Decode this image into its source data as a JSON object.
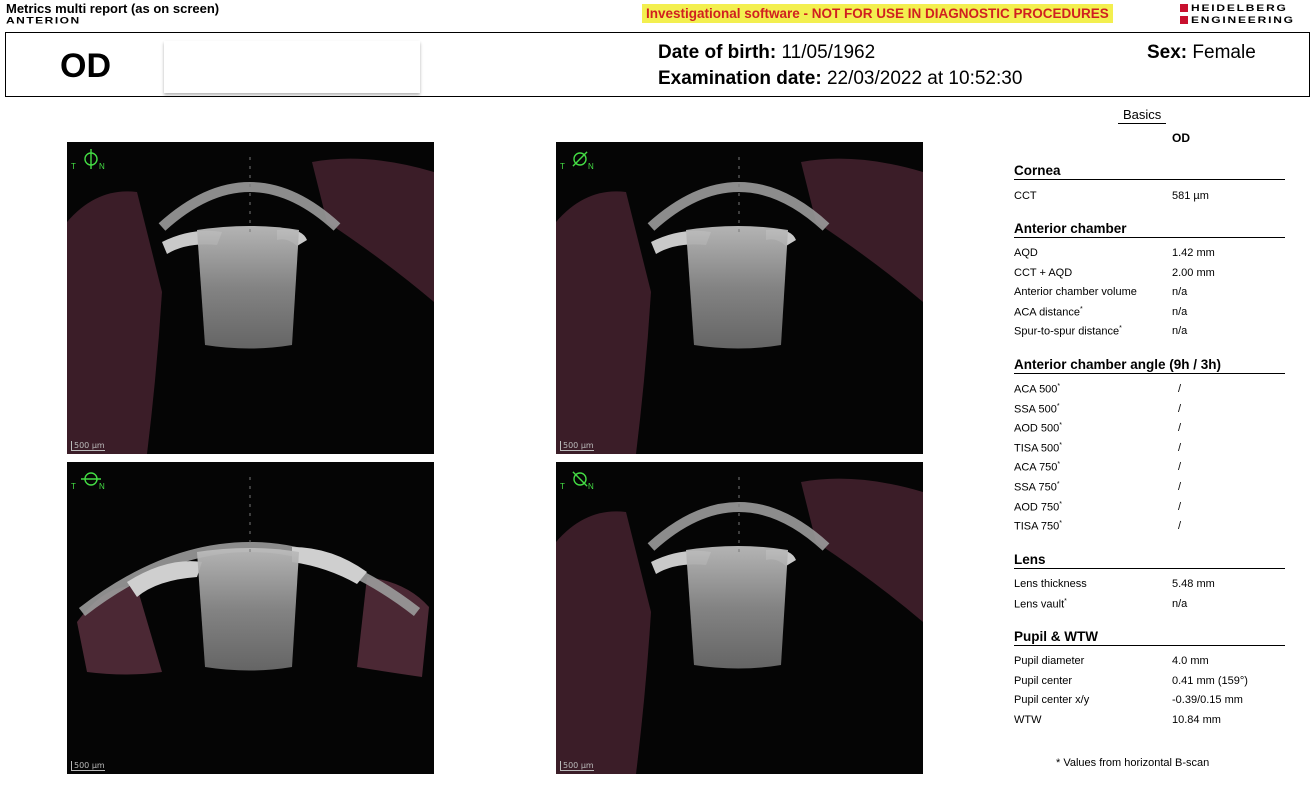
{
  "header": {
    "report_title": "Metrics multi report (as on screen)",
    "app_name": "ANTERION",
    "warning": "Investigational software - NOT FOR USE IN DIAGNOSTIC PROCEDURES",
    "logo_line1": "HEIDELBERG",
    "logo_line2": "ENGINEERING",
    "colors": {
      "warning_bg": "#f3ef4f",
      "warning_text": "#d02020",
      "logo_accent": "#c8102e"
    }
  },
  "patient": {
    "eye": "OD",
    "dob_label": "Date of birth:",
    "dob": "11/05/1962",
    "exam_label": "Examination date:",
    "exam": "22/03/2022 at 10:52:30",
    "sex_label": "Sex:",
    "sex": "Female"
  },
  "scans": [
    {
      "scale": "500 µm",
      "t": "T",
      "n": "N",
      "orientation_deg": 90
    },
    {
      "scale": "500 µm",
      "t": "T",
      "n": "N",
      "orientation_deg": 45
    },
    {
      "scale": "500 µm",
      "t": "T",
      "n": "N",
      "orientation_deg": 0
    },
    {
      "scale": "500 µm",
      "t": "T",
      "n": "N",
      "orientation_deg": 135
    }
  ],
  "panel": {
    "tab": "Basics",
    "column": "OD",
    "sections": {
      "cornea": {
        "title": "Cornea",
        "rows": [
          {
            "k": "CCT",
            "v": "581 µm"
          }
        ]
      },
      "anterior_chamber": {
        "title": "Anterior chamber",
        "rows": [
          {
            "k": "AQD",
            "v": "1.42 mm"
          },
          {
            "k": "CCT + AQD",
            "v": "2.00 mm"
          },
          {
            "k": "Anterior chamber volume",
            "v": "n/a"
          },
          {
            "k": "ACA distance",
            "v": "n/a"
          },
          {
            "k": "Spur-to-spur distance",
            "v": "n/a"
          }
        ]
      },
      "angle": {
        "title": "Anterior chamber angle (9h / 3h)",
        "rows": [
          {
            "k": "ACA 500",
            "v": "/"
          },
          {
            "k": "SSA 500",
            "v": "/"
          },
          {
            "k": "AOD 500",
            "v": "/"
          },
          {
            "k": "TISA 500",
            "v": "/"
          },
          {
            "k": "ACA 750",
            "v": "/"
          },
          {
            "k": "SSA 750",
            "v": "/"
          },
          {
            "k": "AOD 750",
            "v": "/"
          },
          {
            "k": "TISA 750",
            "v": "/"
          }
        ]
      },
      "lens": {
        "title": "Lens",
        "rows": [
          {
            "k": "Lens thickness",
            "v": "5.48 mm"
          },
          {
            "k": "Lens vault",
            "v": "n/a"
          }
        ]
      },
      "pupil": {
        "title": "Pupil & WTW",
        "rows": [
          {
            "k": "Pupil diameter",
            "v": "4.0 mm"
          },
          {
            "k": "Pupil center",
            "v": "0.41 mm (159°)"
          },
          {
            "k": "Pupil center x/y",
            "v": "-0.39/0.15 mm"
          },
          {
            "k": "WTW",
            "v": "10.84 mm"
          }
        ]
      }
    },
    "asterisk": "*",
    "footnote": "* Values from horizontal B-scan"
  }
}
